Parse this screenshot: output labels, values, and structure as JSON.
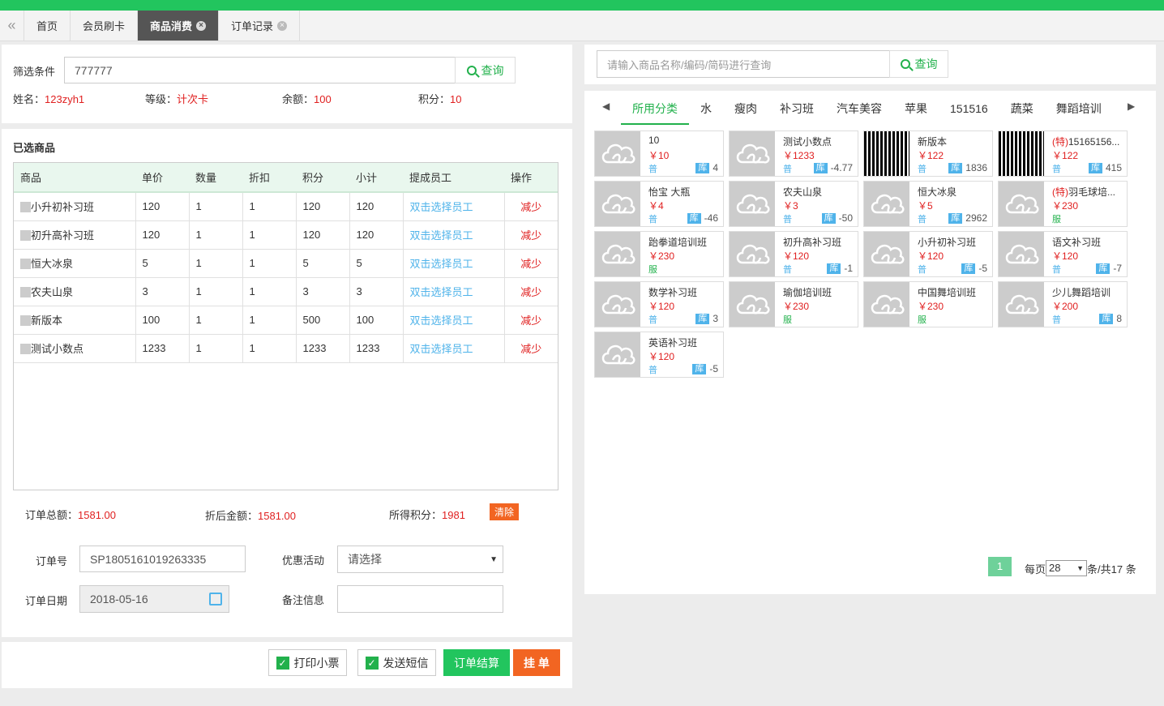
{
  "tabs": {
    "home": "首页",
    "card": "会员刷卡",
    "consume": "商品消费",
    "orders": "订单记录",
    "close": "×",
    "back": "«"
  },
  "filter": {
    "label": "筛选条件",
    "value": "777777",
    "query": "查询"
  },
  "member": {
    "name_label": "姓名：",
    "name": "123zyh1",
    "level_label": "等级：",
    "level": "计次卡",
    "balance_label": "余额：",
    "balance": "100",
    "points_label": "积分：",
    "points": "10"
  },
  "selected": {
    "title": "已选商品",
    "headers": [
      "商品",
      "单价",
      "数量",
      "折扣",
      "积分",
      "小计",
      "提成员工",
      "操作"
    ],
    "rows": [
      {
        "name": "小升初补习班",
        "price": "120",
        "qty": "1",
        "disc": "1",
        "pts": "120",
        "sub": "120",
        "staff": "双击选择员工",
        "op": "减少"
      },
      {
        "name": "初升高补习班",
        "price": "120",
        "qty": "1",
        "disc": "1",
        "pts": "120",
        "sub": "120",
        "staff": "双击选择员工",
        "op": "减少"
      },
      {
        "name": "恒大冰泉",
        "price": "5",
        "qty": "1",
        "disc": "1",
        "pts": "5",
        "sub": "5",
        "staff": "双击选择员工",
        "op": "减少"
      },
      {
        "name": "农夫山泉",
        "price": "3",
        "qty": "1",
        "disc": "1",
        "pts": "3",
        "sub": "3",
        "staff": "双击选择员工",
        "op": "减少"
      },
      {
        "name": "新版本",
        "price": "100",
        "qty": "1",
        "disc": "1",
        "pts": "500",
        "sub": "100",
        "staff": "双击选择员工",
        "op": "减少"
      },
      {
        "name": "测试小数点",
        "price": "1233",
        "qty": "1",
        "disc": "1",
        "pts": "1233",
        "sub": "1233",
        "staff": "双击选择员工",
        "op": "减少"
      }
    ]
  },
  "summary": {
    "total_label": "订单总额：",
    "total": "1581.00",
    "after_label": "折后金额：",
    "after": "1581.00",
    "pts_label": "所得积分：",
    "pts": "1981",
    "clear": "清除"
  },
  "order": {
    "no_label": "订单号",
    "no": "SP1805161019263335",
    "promo_label": "优惠活动",
    "promo": "请选择",
    "date_label": "订单日期",
    "date": "2018-05-16",
    "remark_label": "备注信息",
    "remark": ""
  },
  "actions": {
    "print": "打印小票",
    "sms": "发送短信",
    "settle": "订单结算",
    "hang": "挂 单",
    "check": "✓"
  },
  "search": {
    "placeholder": "请输入商品名称/编码/简码进行查询",
    "query": "查询"
  },
  "categories": [
    "所用分类",
    "水",
    "瘦肉",
    "补习班",
    "汽车美容",
    "苹果",
    "151516",
    "蔬菜",
    "舞蹈培训"
  ],
  "products": [
    {
      "name": "10",
      "price": "￥10",
      "tag": "普",
      "stock": "4",
      "qr": false
    },
    {
      "name": "测试小数点",
      "price": "￥1233",
      "tag": "普",
      "stock": "-4.77",
      "qr": false
    },
    {
      "name": "新版本",
      "price": "￥122",
      "tag": "普",
      "stock": "1836",
      "qr": true
    },
    {
      "prefix": "(特)",
      "name": "15165156...",
      "price": "￥122",
      "tag": "普",
      "stock": "415",
      "qr": true
    },
    {
      "name": "怡宝 大瓶",
      "price": "￥4",
      "tag": "普",
      "stock": "-46",
      "qr": false
    },
    {
      "name": "农夫山泉",
      "price": "￥3",
      "tag": "普",
      "stock": "-50",
      "qr": false
    },
    {
      "name": "恒大冰泉",
      "price": "￥5",
      "tag": "普",
      "stock": "2962",
      "qr": false
    },
    {
      "prefix": "(特)",
      "name": "羽毛球培...",
      "price": "￥230",
      "tag": "服",
      "stock": "",
      "qr": false
    },
    {
      "name": "跆拳道培训班",
      "price": "￥230",
      "tag": "服",
      "stock": "",
      "qr": false
    },
    {
      "name": "初升高补习班",
      "price": "￥120",
      "tag": "普",
      "stock": "-1",
      "qr": false
    },
    {
      "name": "小升初补习班",
      "price": "￥120",
      "tag": "普",
      "stock": "-5",
      "qr": false
    },
    {
      "name": "语文补习班",
      "price": "￥120",
      "tag": "普",
      "stock": "-7",
      "qr": false
    },
    {
      "name": "数学补习班",
      "price": "￥120",
      "tag": "普",
      "stock": "3",
      "qr": false
    },
    {
      "name": "瑜伽培训班",
      "price": "￥230",
      "tag": "服",
      "stock": "",
      "qr": false
    },
    {
      "name": "中国舞培训班",
      "price": "￥230",
      "tag": "服",
      "stock": "",
      "qr": false
    },
    {
      "name": "少儿舞蹈培训",
      "price": "￥200",
      "tag": "普",
      "stock": "8",
      "qr": false
    },
    {
      "name": "英语补习班",
      "price": "￥120",
      "tag": "普",
      "stock": "-5",
      "qr": false
    }
  ],
  "stock_label": "库",
  "pager": {
    "page": "1",
    "per_label": "每页",
    "per": "28",
    "total": "条/共17 条"
  },
  "colors": {
    "green": "#22b14c",
    "red": "#e02020",
    "blue": "#4fb3ea",
    "orange": "#f26522"
  }
}
